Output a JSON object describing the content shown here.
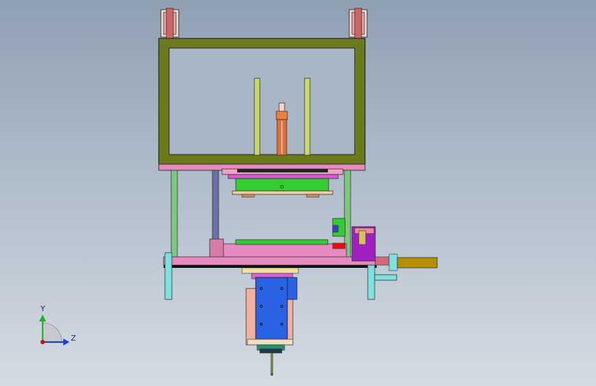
{
  "viewport": {
    "background_top": "#8fa0b3",
    "background_bottom": "#d5dbe2"
  },
  "colors": {
    "frame": "#6b7a1a",
    "rail": "#7ec87e",
    "plate_pink": "#e68ac0",
    "plate_green": "#33cc33",
    "motor_blue": "#2a62e6",
    "shaft_gold": "#b38f00",
    "bracket_cyan": "#7fe0e0",
    "cylinder_orange": "#e0703a",
    "accent_magenta": "#a020c0",
    "accent_red": "#e01010"
  },
  "triad": {
    "y_label": "Y",
    "z_label": "Z",
    "icons": [
      "axis-y-icon",
      "axis-z-icon",
      "axis-x-origin-icon"
    ]
  }
}
